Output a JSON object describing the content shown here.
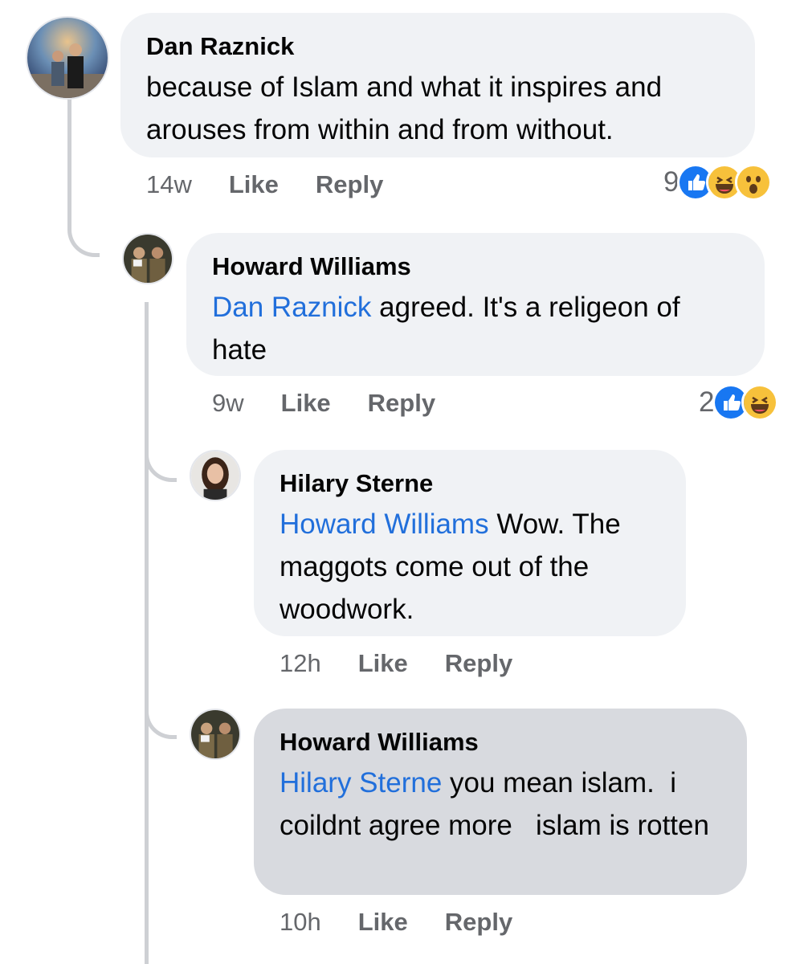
{
  "comments": [
    {
      "author": "Dan Raznick",
      "mention": "",
      "text": "because of Islam and what it inspires and arouses from within and from without.",
      "time": "14w",
      "like_label": "Like",
      "reply_label": "Reply",
      "reaction_count": "9",
      "reactions": [
        "like-icon",
        "haha-icon",
        "wow-icon"
      ]
    },
    {
      "author": "Howard Williams",
      "mention": "Dan Raznick",
      "text": " agreed. It's a religeon of hate",
      "time": "9w",
      "like_label": "Like",
      "reply_label": "Reply",
      "reaction_count": "2",
      "reactions": [
        "like-icon",
        "haha-icon"
      ]
    },
    {
      "author": "Hilary Sterne",
      "mention": "Howard Williams",
      "text": " Wow. The maggots come out of the woodwork.",
      "time": "12h",
      "like_label": "Like",
      "reply_label": "Reply"
    },
    {
      "author": "Howard Williams",
      "mention": "Hilary Sterne",
      "text": " you mean islam.  i coildnt agree more   islam is rotten",
      "time": "10h",
      "like_label": "Like",
      "reply_label": "Reply"
    }
  ],
  "colors": {
    "bubble": "#f0f2f5",
    "bubble_highlight": "#d8dadf",
    "mention": "#216fdb",
    "meta": "#65676b",
    "like_blue": "#1877f2",
    "haha_yellow": "#f7c13b"
  }
}
